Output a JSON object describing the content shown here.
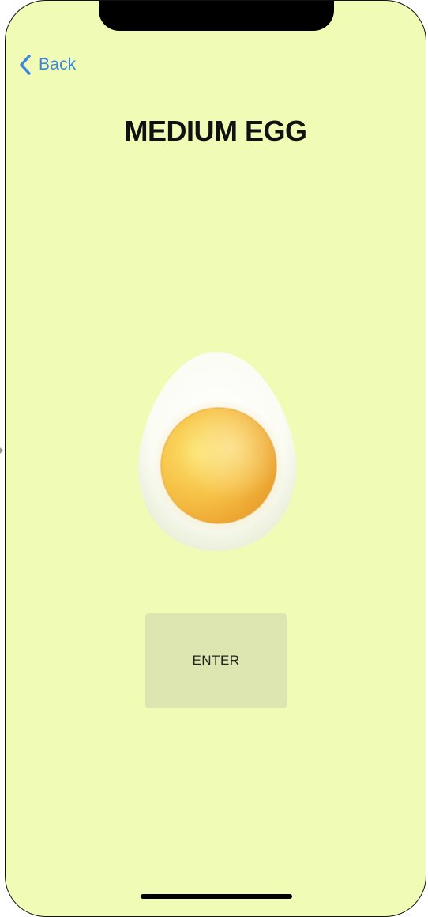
{
  "nav": {
    "back_label": "Back",
    "back_icon": "chevron-left-icon"
  },
  "page": {
    "title": "MEDIUM EGG"
  },
  "image": {
    "subject": "halved-boiled-egg"
  },
  "actions": {
    "enter_label": "ENTER"
  },
  "colors": {
    "background": "#f0fcb6",
    "accent": "#3a84e4",
    "button_bg": "#dde5b0",
    "title": "#111111"
  }
}
